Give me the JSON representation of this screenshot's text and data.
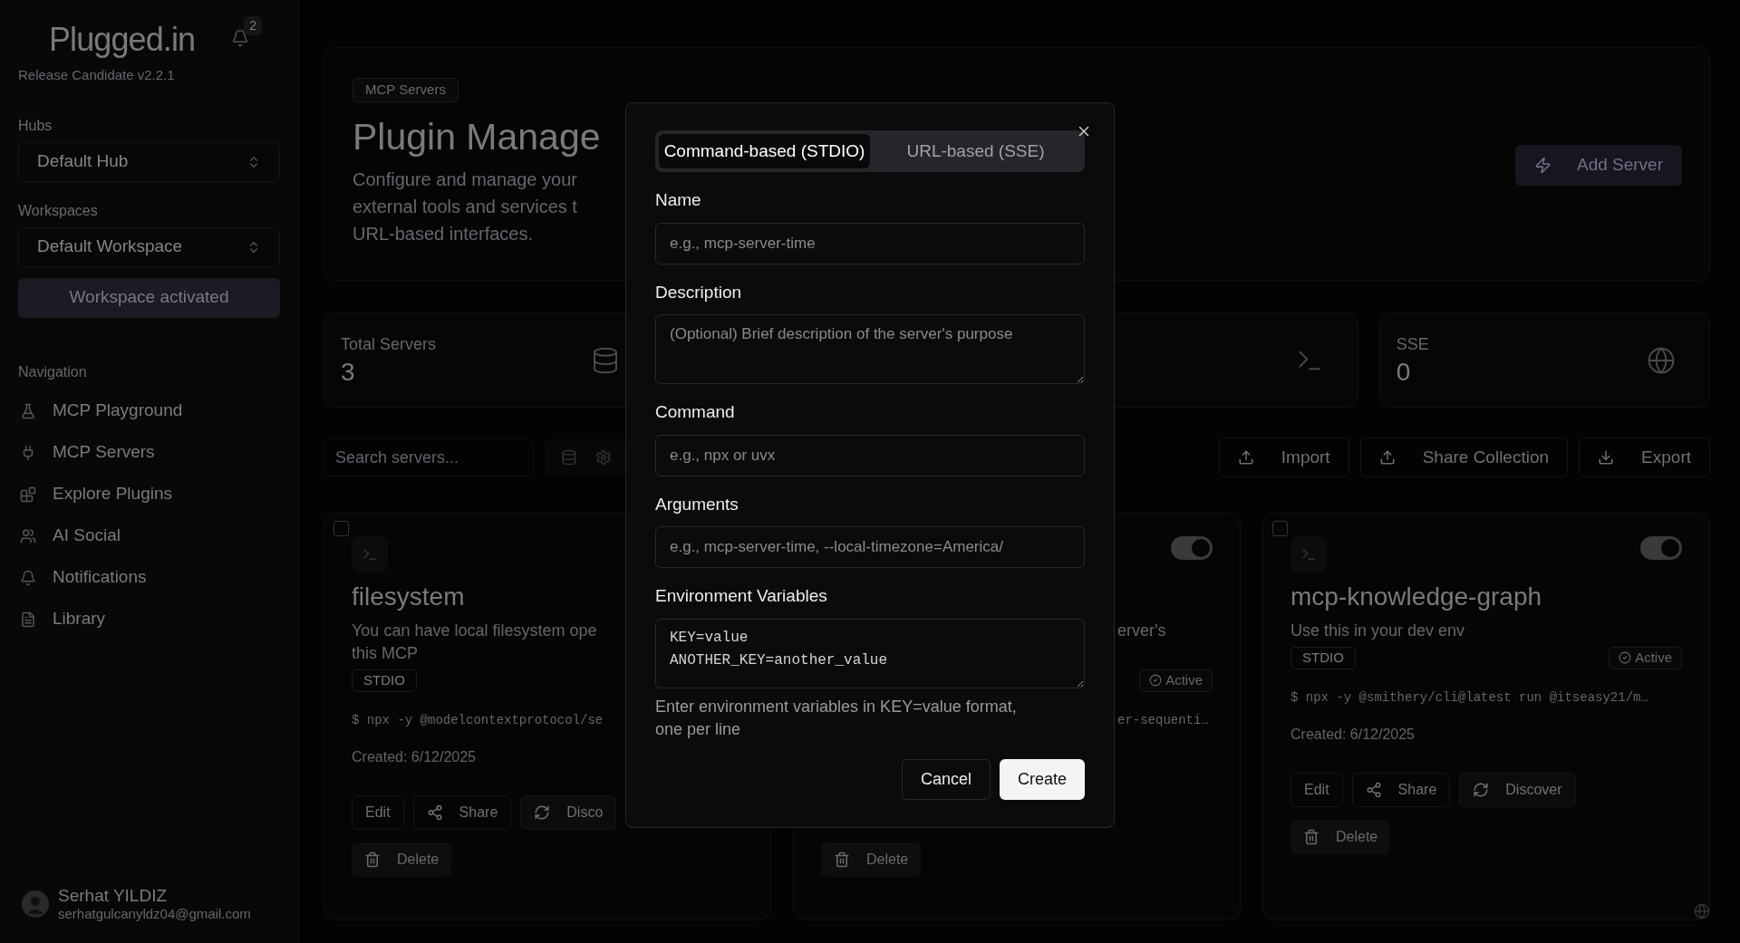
{
  "sidebar": {
    "logo": "Plugged.in",
    "notification_count": "2",
    "version": "Release Candidate v2.2.1",
    "hubs": {
      "label": "Hubs",
      "value": "Default Hub"
    },
    "workspaces": {
      "label": "Workspaces",
      "value": "Default Workspace"
    },
    "workspace_button": "Workspace activated",
    "navigation_heading": "Navigation",
    "nav_items": [
      {
        "label": "MCP Playground"
      },
      {
        "label": "MCP Servers"
      },
      {
        "label": "Explore Plugins"
      },
      {
        "label": "AI Social"
      },
      {
        "label": "Notifications"
      },
      {
        "label": "Library"
      }
    ],
    "user": {
      "name": "Serhat YILDIZ",
      "email": "serhatgulcanyldz04@gmail.com"
    }
  },
  "header": {
    "badge": "MCP Servers",
    "title": "Plugin Manage",
    "description_lines": [
      "Configure and manage your",
      "external tools and services t",
      "URL-based interfaces."
    ],
    "add_button": "Add Server"
  },
  "stats": [
    {
      "kind": "database",
      "label": "Total Servers",
      "value": "3"
    },
    {
      "kind": "terminal"
    },
    {
      "kind": "globe",
      "label": "SSE",
      "value": "0"
    }
  ],
  "toolbar": {
    "search_placeholder": "Search servers...",
    "actions": [
      "Import",
      "Share Collection",
      "Export"
    ]
  },
  "servers": [
    {
      "checked": false,
      "name": "filesystem",
      "description_lines": [
        "You can have local filesystem ope",
        "this MCP"
      ],
      "type": "STDIO",
      "command": "$ npx -y @modelcontextprotocol/se",
      "created": "Created: 6/12/2025",
      "actions": [
        "Edit",
        "Share",
        "Disco"
      ],
      "delete": "Delete"
    },
    {
      "enabled": true,
      "description_lines": [
        "erver's"
      ],
      "status": "Active",
      "command": "er-sequenti…",
      "delete": "Delete"
    },
    {
      "checked": false,
      "enabled": true,
      "name": "mcp-knowledge-graph",
      "description_lines": [
        "Use this in your dev env"
      ],
      "type": "STDIO",
      "status": "Active",
      "command": "$ npx -y @smithery/cli@latest run @itseasy21/m…",
      "created": "Created: 6/12/2025",
      "actions": [
        "Edit",
        "Share",
        "Discover"
      ],
      "delete": "Delete"
    }
  ],
  "dialog": {
    "tabs": [
      {
        "label": "Command-based (STDIO)",
        "selected": true
      },
      {
        "label": "URL-based (SSE)",
        "selected": false
      }
    ],
    "fields": [
      {
        "label": "Name",
        "kind": "input",
        "placeholder": "e.g., mcp-server-time"
      },
      {
        "label": "Description",
        "kind": "textarea",
        "placeholder": "(Optional) Brief description of the server's purpose"
      },
      {
        "label": "Command",
        "kind": "input",
        "placeholder": "e.g., npx or uvx"
      },
      {
        "label": "Arguments",
        "kind": "input",
        "placeholder": "e.g., mcp-server-time, --local-timezone=America/"
      },
      {
        "label": "Environment Variables",
        "kind": "code",
        "value": "KEY=value\nANOTHER_KEY=another_value",
        "help": "Enter environment variables in KEY=value format, one per line"
      }
    ],
    "buttons": [
      {
        "label": "Cancel",
        "kind": "secondary"
      },
      {
        "label": "Create",
        "kind": "primary"
      }
    ]
  }
}
